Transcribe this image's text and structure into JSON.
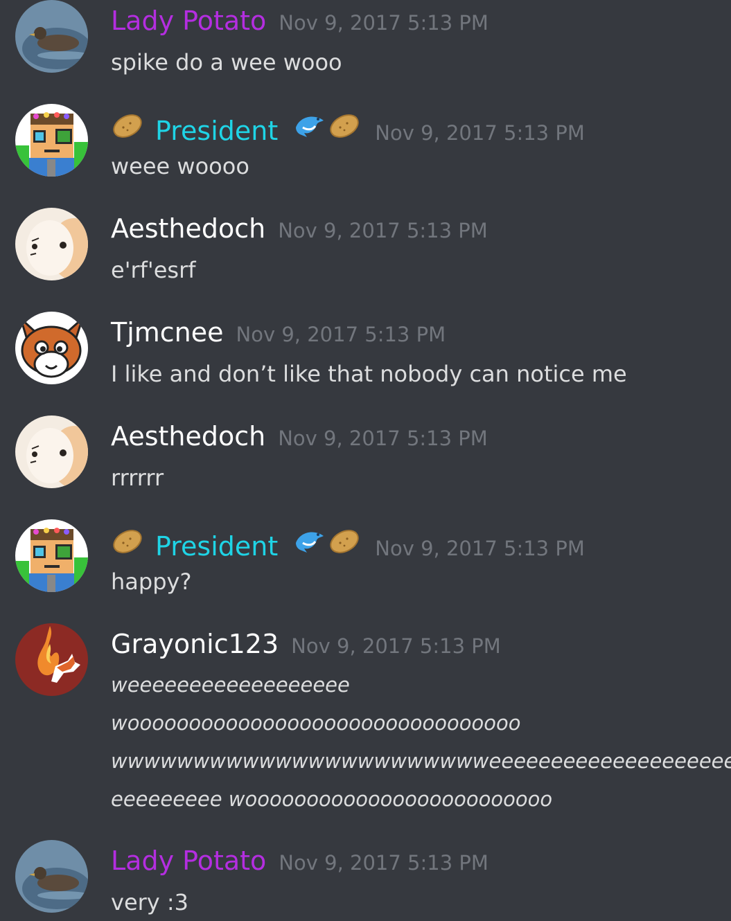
{
  "colors": {
    "background": "#36393f",
    "lady_potato": "#b42ee0",
    "president": "#1fd4e6",
    "default_name": "#ffffff",
    "timestamp": "#72767d",
    "message_text": "#dcddde"
  },
  "messages": [
    {
      "author": "Lady Potato",
      "timestamp": "Nov 9, 2017 5:13 PM",
      "lines": [
        "spike do a wee wooo"
      ]
    },
    {
      "author": "President",
      "timestamp": "Nov 9, 2017 5:13 PM",
      "lines": [
        "weee woooo"
      ]
    },
    {
      "author": "Aesthedoch",
      "timestamp": "Nov 9, 2017 5:13 PM",
      "lines": [
        "e'rf'esrf"
      ]
    },
    {
      "author": "Tjmcnee",
      "timestamp": "Nov 9, 2017 5:13 PM",
      "lines": [
        "I like and don’t like that nobody can notice me"
      ]
    },
    {
      "author": "Aesthedoch",
      "timestamp": "Nov 9, 2017 5:13 PM",
      "lines": [
        "rrrrrr"
      ]
    },
    {
      "author": "President",
      "timestamp": "Nov 9, 2017 5:13 PM",
      "lines": [
        "happy?"
      ]
    },
    {
      "author": "Grayonic123",
      "timestamp": "Nov 9, 2017 5:13 PM",
      "lines": [
        "weeeeeeeeeeeeeeeeee",
        "woooooooooooooooooooooooooooooooo",
        "wwwwwwwwwwwwwwwwwwwwwwweeeeeeeeeeeeeeeeeeee",
        "eeeeeeeee wooooooooooooooooooooooooo"
      ]
    },
    {
      "author": "Lady Potato",
      "timestamp": "Nov 9, 2017 5:13 PM",
      "lines": [
        "very :3"
      ]
    }
  ]
}
